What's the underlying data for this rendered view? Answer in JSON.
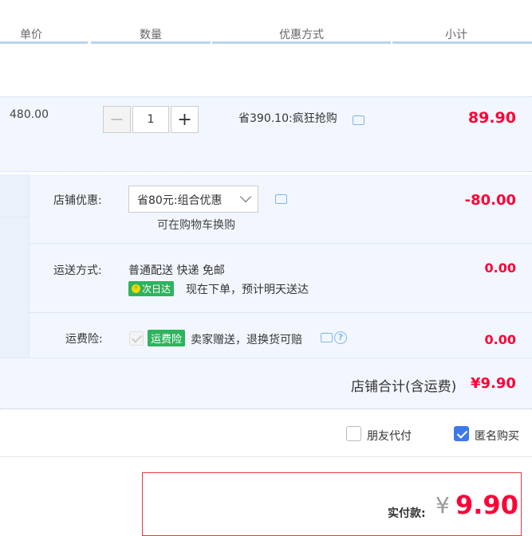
{
  "header": {
    "columns": [
      "单价",
      "数量",
      "优惠方式",
      "小计"
    ]
  },
  "product": {
    "unit_price": "480.00",
    "quantity": "1",
    "minus_symbol": "−",
    "plus_symbol": "+",
    "discount": "省390.10:疯狂抢购",
    "subtotal": "89.90"
  },
  "shop": {
    "coupon_label": "店铺优惠:",
    "coupon_select": "省80元:组合优惠",
    "coupon_hint": "可在购物车换购",
    "coupon_amount": "-80.00",
    "delivery_label": "运送方式:",
    "delivery_method": "普通配送 快递 免邮",
    "delivery_badge": "次日达",
    "delivery_note": "现在下单，预计明天送达",
    "delivery_amount": "0.00",
    "insurance_label": "运费险:",
    "insurance_badge": "运费险",
    "insurance_note": "卖家赠送，退换货可赔",
    "insurance_amount": "0.00",
    "total_label": "店铺合计(含运费)",
    "total_amount": "¥9.90"
  },
  "options": {
    "friend_pay": "朋友代付",
    "anonymous": "匿名购买",
    "friend_pay_checked": false,
    "anonymous_checked": true
  },
  "payment": {
    "label": "实付款:",
    "currency": "¥",
    "amount": "9.90"
  },
  "colors": {
    "accent_red": "#ff0036",
    "header_line": "#b8d3f1",
    "panel_bg": "#f2f7ff",
    "badge_green": "#2eb35e",
    "checkbox_blue": "#3d7ae8"
  }
}
